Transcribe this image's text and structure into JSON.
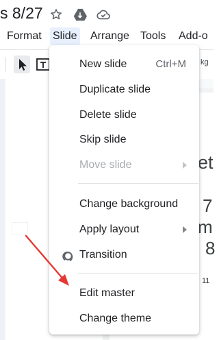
{
  "document": {
    "title_fragment": "s 8/27"
  },
  "menubar": {
    "items": [
      "Format",
      "Slide",
      "Arrange",
      "Tools",
      "Add-o"
    ],
    "active": "Slide"
  },
  "toolbar": {
    "partial_text": "kg"
  },
  "slide_dropdown": {
    "items": [
      {
        "label": "New slide",
        "shortcut": "Ctrl+M"
      },
      {
        "label": "Duplicate slide"
      },
      {
        "label": "Delete slide"
      },
      {
        "label": "Skip slide"
      },
      {
        "label": "Move slide",
        "disabled": true,
        "submenu": true
      },
      {
        "label": "Change background"
      },
      {
        "label": "Apply layout",
        "submenu": true
      },
      {
        "label": "Transition",
        "icon": "transition-icon"
      },
      {
        "label": "Edit master"
      },
      {
        "label": "Change theme"
      }
    ]
  },
  "slide_canvas_fragments": [
    "et",
    "7",
    "m",
    "8",
    "11"
  ],
  "colors": {
    "accent_active": "#e8f0fe",
    "annotation_arrow": "#e53935"
  },
  "icons": [
    "star-icon",
    "move-to-drive-icon",
    "cloud-saved-icon",
    "select-cursor-icon",
    "text-box-icon",
    "transition-icon"
  ]
}
